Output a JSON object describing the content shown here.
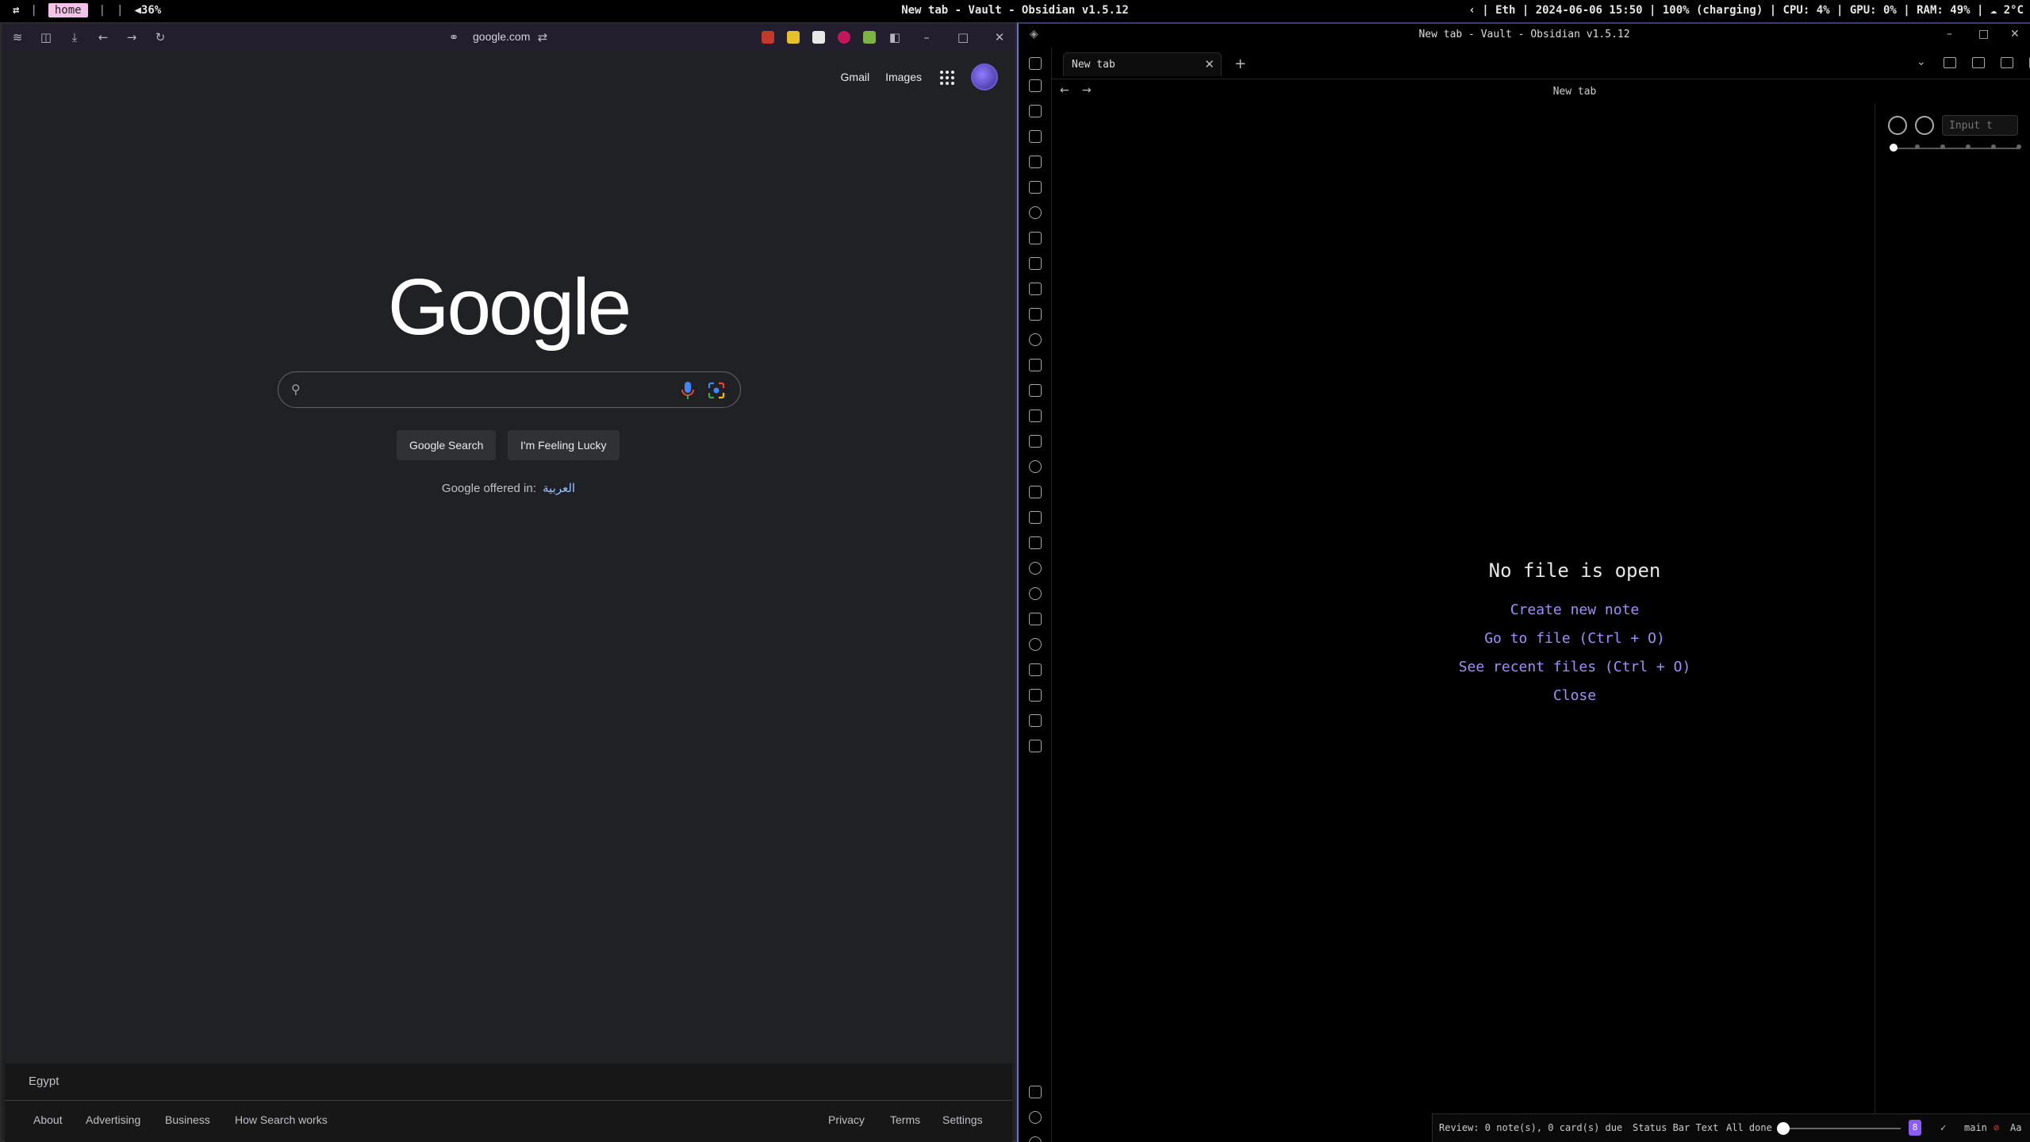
{
  "topbar": {
    "workspace_icon": "⇄",
    "workspace": "home",
    "sep": "|",
    "volume": "◀36%",
    "window_title": "New tab - Vault - Obsidian v1.5.12",
    "status": "‹ | Eth | 2024-06-06 15:50 | 100% (charging) | CPU: 4% | GPU: 0% | RAM: 49% | ☁ 2°C"
  },
  "browser": {
    "url": "google.com",
    "header": {
      "gmail": "Gmail",
      "images": "Images"
    },
    "logo": "Google",
    "search_placeholder": "",
    "buttons": {
      "search": "Google Search",
      "lucky": "I'm Feeling Lucky"
    },
    "offered_label": "Google offered in:",
    "offered_lang": "العربية",
    "footer": {
      "country": "Egypt",
      "links_left": [
        "About",
        "Advertising",
        "Business",
        "How Search works"
      ],
      "links_right": [
        "Privacy",
        "Terms",
        "Settings"
      ]
    },
    "colors": {
      "page_bg": "#202124",
      "toolbar_bg": "#231e2e",
      "link": "#99c3ff"
    }
  },
  "obsidian": {
    "window_title": "New tab - Vault - Obsidian v1.5.12",
    "tab_label": "New tab",
    "view_title": "New tab",
    "empty_state": {
      "title": "No file is open",
      "links": [
        "Create new note",
        "Go to file (Ctrl + O)",
        "See recent files (Ctrl + O)",
        "Close"
      ]
    },
    "right_panel": {
      "input_placeholder": "Input t"
    },
    "statusbar": {
      "review": "Review: 0 note(s), 0 card(s) due",
      "status_text": "Status Bar Text",
      "all_done": "All done",
      "badge": "8",
      "check": "✓",
      "branch": "main",
      "font": "Aa"
    },
    "colors": {
      "accent": "#a78bfa",
      "badge": "#8b5cf6",
      "border": "#6a6fd8"
    }
  }
}
